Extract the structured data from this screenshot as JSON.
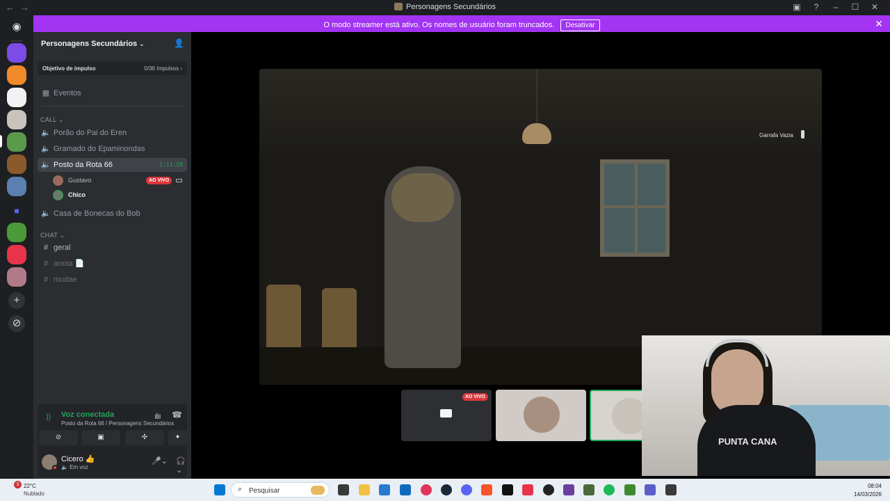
{
  "window": {
    "title": "Personagens Secundários",
    "nav_back": "←",
    "nav_fwd": "→"
  },
  "banner": {
    "text": "O modo streamer está ativo. Os nomes de usuário foram truncados.",
    "button": "Desativar",
    "close": "✕"
  },
  "server": {
    "name": "Personagens Secundários",
    "boost_label": "Objetivo de impulso",
    "boost_value": "0/36 Impulsos ›",
    "events": "Eventos"
  },
  "categories": {
    "call": "CALL ⌄",
    "chat": "CHAT ⌄"
  },
  "voice_channels": [
    {
      "name": "Porão do Pai do Eren"
    },
    {
      "name": "Gramado do Epaminondas"
    },
    {
      "name": "Posto da Rota 66",
      "timer": "1:11:58"
    },
    {
      "name": "Casa de Bonecas do Bob"
    }
  ],
  "voice_users": [
    {
      "name": "Gustavo",
      "badge": "AO VIVO"
    },
    {
      "name": "Chico"
    }
  ],
  "text_channels": [
    {
      "name": "geral"
    },
    {
      "name": "anota 📄"
    },
    {
      "name": "mudae"
    }
  ],
  "voice_panel": {
    "status": "Voz conectada",
    "channel": "Posto da Rota 66 / Personagens Secundários"
  },
  "user_panel": {
    "name": "Cicero 👍",
    "status": "Em voz"
  },
  "stream": {
    "hud_text": "Garrafa Vazia",
    "thumb_live": "AO VIVO",
    "shirt_text": "PUNTA CANA"
  },
  "taskbar": {
    "weather_badge": "3",
    "temp": "22°C",
    "condition": "Nublado",
    "search_placeholder": "Pesquisar",
    "time": "08:04",
    "date": "14/03/2026"
  },
  "colors": {
    "banner": "#a234f2",
    "online_green": "#23a55a",
    "live_red": "#da373c"
  }
}
